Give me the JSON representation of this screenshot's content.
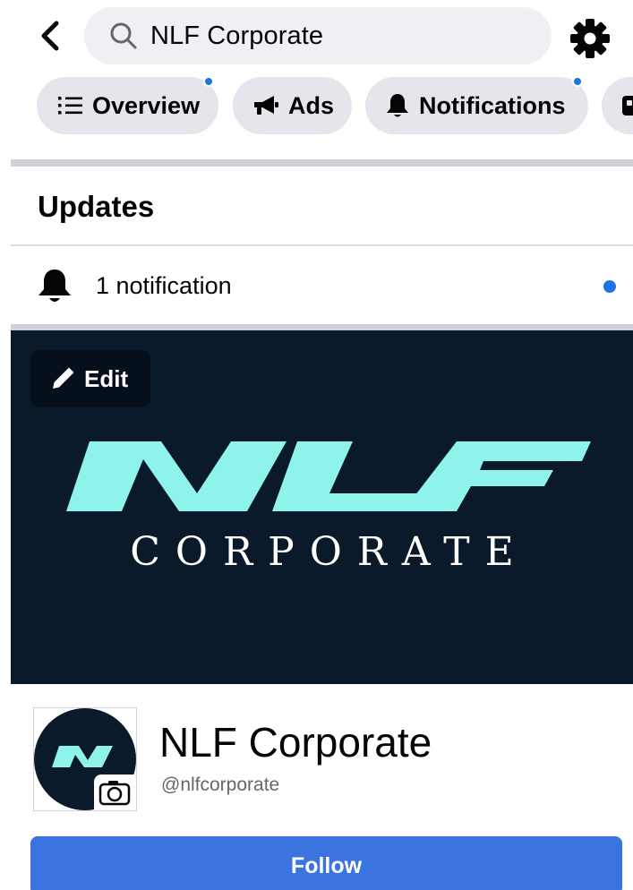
{
  "header": {
    "back_icon": "chevron-left-icon",
    "search_query": "NLF Corporate",
    "search_icon": "search-icon",
    "settings_icon": "gear-icon"
  },
  "tabs": [
    {
      "label": "Overview",
      "icon": "list-icon",
      "has_dot": true
    },
    {
      "label": "Ads",
      "icon": "megaphone-icon",
      "has_dot": false
    },
    {
      "label": "Notifications",
      "icon": "bell-icon",
      "has_dot": true
    },
    {
      "label": "",
      "icon": "partially-visible-tab-icon",
      "has_dot": false
    }
  ],
  "updates": {
    "title": "Updates",
    "notification_text": "1 notification",
    "unread": true
  },
  "cover": {
    "edit_label": "Edit",
    "logo_text": "NLF",
    "logo_subtitle": "CORPORATE"
  },
  "profile": {
    "name": "NLF Corporate",
    "handle": "@nlfcorporate",
    "camera_icon": "camera-icon"
  },
  "actions": {
    "follow_label": "Follow"
  },
  "colors": {
    "accent_blue": "#1b74e4",
    "follow_button": "#3b74df",
    "cover_background": "#0b1a2a",
    "logo_teal": "#8ef3ea",
    "chip_background": "#e4e6eb",
    "search_background": "#eef0f3"
  }
}
